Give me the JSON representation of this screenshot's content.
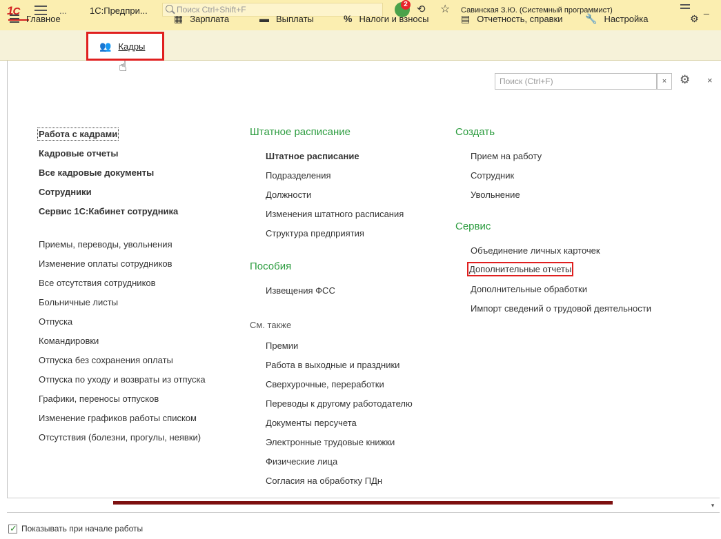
{
  "titlebar": {
    "dots": "...",
    "app_name": "1С:Предпри...",
    "search_placeholder": "Поиск Ctrl+Shift+F",
    "notifications_count": "2",
    "user": "Савинская З.Ю. (Системный программист)"
  },
  "sections": [
    {
      "label": "Главное",
      "icon": "menu-icon"
    },
    {
      "label": "Кадры",
      "icon": "people-icon"
    },
    {
      "label": "Зарплата",
      "icon": "calculator-icon"
    },
    {
      "label": "Выплаты",
      "icon": "payment-icon"
    },
    {
      "label": "Налоги и взносы",
      "icon": "percent-icon"
    },
    {
      "label": "Отчетность, справки",
      "icon": "report-icon"
    },
    {
      "label": "Настройка",
      "icon": "wrench-icon"
    }
  ],
  "panel_search": {
    "placeholder": "Поиск (Ctrl+F)",
    "clear": "×"
  },
  "col1": {
    "bold_links": [
      "Работа с кадрами",
      "Кадровые отчеты",
      "Все кадровые документы",
      "Сотрудники",
      "Сервис 1С:Кабинет сотрудника"
    ],
    "links": [
      "Приемы, переводы, увольнения",
      "Изменение оплаты сотрудников",
      "Все отсутствия сотрудников",
      "Больничные листы",
      "Отпуска",
      "Командировки",
      "Отпуска без сохранения оплаты",
      "Отпуска по уходу и возвраты из отпуска",
      "Графики, переносы отпусков",
      "Изменение графиков работы списком",
      "Отсутствия (болезни, прогулы, неявки)"
    ]
  },
  "col2": {
    "staffing_header": "Штатное расписание",
    "staffing_links": [
      "Штатное расписание",
      "Подразделения",
      "Должности",
      "Изменения штатного расписания",
      "Структура предприятия"
    ],
    "benefits_header": "Пособия",
    "benefits_links": [
      "Извещения ФСС"
    ],
    "see_also_label": "См. также",
    "see_also_links": [
      "Премии",
      "Работа в выходные и праздники",
      "Сверхурочные, переработки",
      "Переводы к другому работодателю",
      "Документы персучета",
      "Электронные трудовые книжки",
      "Физические лица",
      "Согласия на обработку ПДн"
    ]
  },
  "col3": {
    "create_header": "Создать",
    "create_links": [
      "Прием на работу",
      "Сотрудник",
      "Увольнение"
    ],
    "service_header": "Сервис",
    "service_links": [
      "Объединение личных карточек",
      "Дополнительные отчеты",
      "Дополнительные обработки",
      "Импорт сведений о трудовой деятельности"
    ]
  },
  "footer": {
    "show_on_start": "Показывать при начале работы"
  }
}
